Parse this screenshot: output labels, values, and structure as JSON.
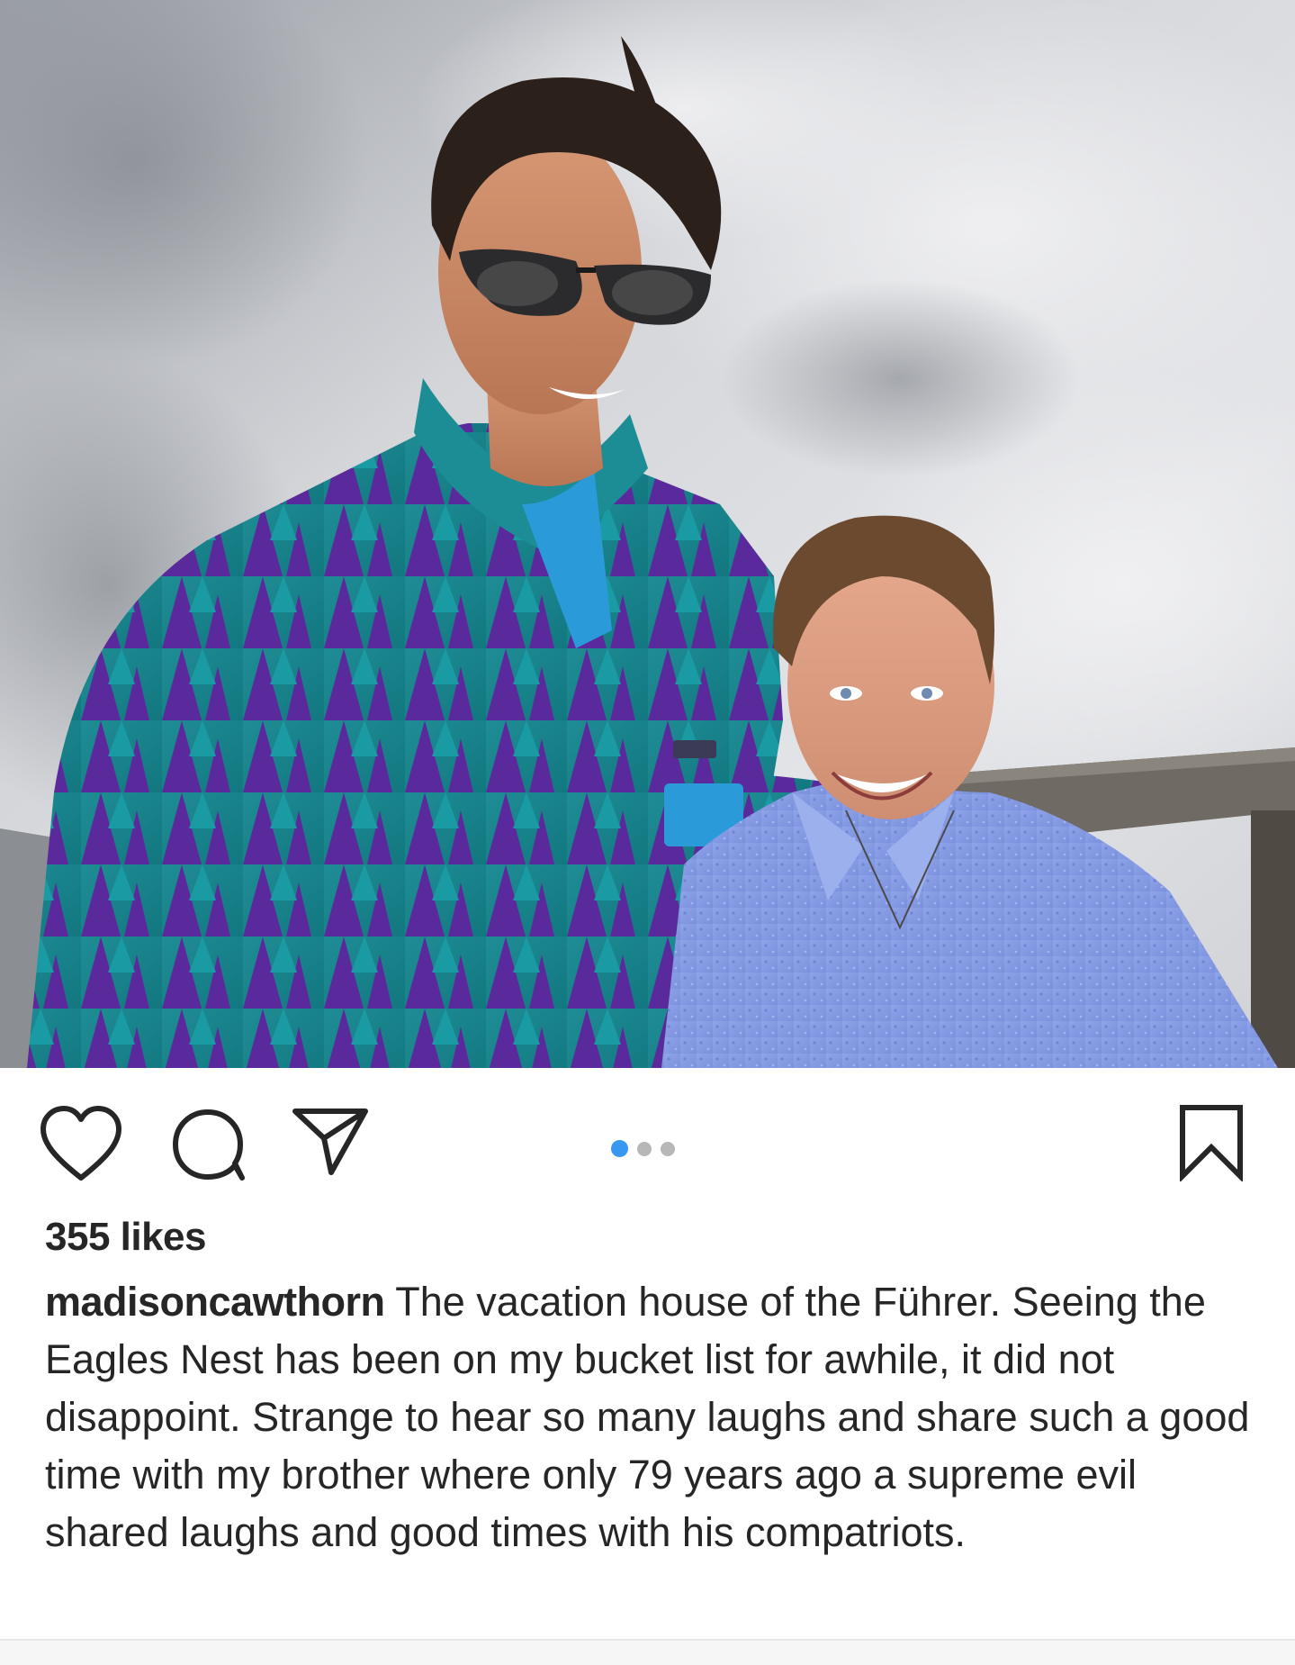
{
  "post": {
    "photo": {
      "alt_subject": "two men smiling outdoors in front of cloudy mountain view",
      "carousel": {
        "total": 3,
        "active_index": 0
      }
    },
    "actions": {
      "like_icon": "heart-icon",
      "comment_icon": "comment-bubble-icon",
      "share_icon": "paper-plane-icon",
      "save_icon": "bookmark-icon"
    },
    "likes_text": "355 likes",
    "caption": {
      "username": "madisoncawthorn",
      "text": " The vacation house of the Führer. Seeing the Eagles Nest has been on my bucket list for awhile, it did not disappoint. Strange to hear so many laughs and share such a good time with my brother where only 79 years ago a supreme evil shared laughs and good times with his compatriots."
    }
  },
  "colors": {
    "accent_blue": "#3897f0",
    "dot_inactive": "#b7b7b7",
    "text": "#262626"
  }
}
